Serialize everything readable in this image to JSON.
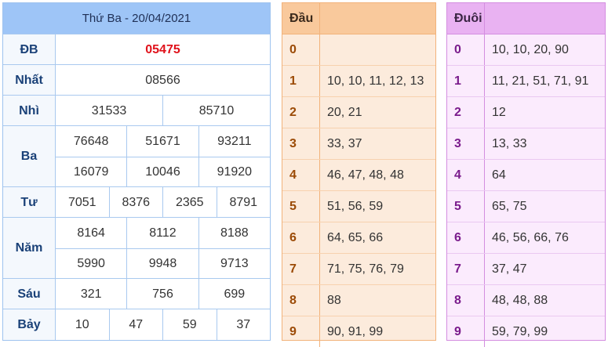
{
  "results": {
    "title": "Thứ Ba - 20/04/2021",
    "rows": [
      {
        "label": "ĐB",
        "lines": [
          [
            "05475"
          ]
        ]
      },
      {
        "label": "Nhất",
        "lines": [
          [
            "08566"
          ]
        ]
      },
      {
        "label": "Nhì",
        "lines": [
          [
            "31533",
            "85710"
          ]
        ]
      },
      {
        "label": "Ba",
        "lines": [
          [
            "76648",
            "51671",
            "93211"
          ],
          [
            "16079",
            "10046",
            "91920"
          ]
        ]
      },
      {
        "label": "Tư",
        "lines": [
          [
            "7051",
            "8376",
            "2365",
            "8791"
          ]
        ]
      },
      {
        "label": "Năm",
        "lines": [
          [
            "8164",
            "8112",
            "8188"
          ],
          [
            "5990",
            "9948",
            "9713"
          ]
        ]
      },
      {
        "label": "Sáu",
        "lines": [
          [
            "321",
            "756",
            "699"
          ]
        ]
      },
      {
        "label": "Bảy",
        "lines": [
          [
            "10",
            "47",
            "59",
            "37"
          ]
        ]
      }
    ]
  },
  "dau": {
    "header": "Đầu",
    "rows": [
      {
        "k": "0",
        "v": ""
      },
      {
        "k": "1",
        "v": "10, 10, 11, 12, 13"
      },
      {
        "k": "2",
        "v": "20, 21"
      },
      {
        "k": "3",
        "v": "33, 37"
      },
      {
        "k": "4",
        "v": "46, 47, 48, 48"
      },
      {
        "k": "5",
        "v": "51, 56, 59"
      },
      {
        "k": "6",
        "v": "64, 65, 66"
      },
      {
        "k": "7",
        "v": "71, 75, 76, 79"
      },
      {
        "k": "8",
        "v": "88"
      },
      {
        "k": "9",
        "v": "90, 91, 99"
      }
    ]
  },
  "duoi": {
    "header": "Đuôi",
    "rows": [
      {
        "k": "0",
        "v": "10, 10, 20, 90"
      },
      {
        "k": "1",
        "v": "11, 21, 51, 71, 91"
      },
      {
        "k": "2",
        "v": "12"
      },
      {
        "k": "3",
        "v": "13, 33"
      },
      {
        "k": "4",
        "v": "64"
      },
      {
        "k": "5",
        "v": "65, 75"
      },
      {
        "k": "6",
        "v": "46, 56, 66, 76"
      },
      {
        "k": "7",
        "v": "37, 47"
      },
      {
        "k": "8",
        "v": "48, 48, 88"
      },
      {
        "k": "9",
        "v": "59, 79, 99"
      }
    ]
  },
  "colors": {
    "special_prize": "#e0121b",
    "results_header": "#9ec5f7",
    "dau_header": "#f9c99c",
    "duoi_header": "#e9b2f2"
  }
}
